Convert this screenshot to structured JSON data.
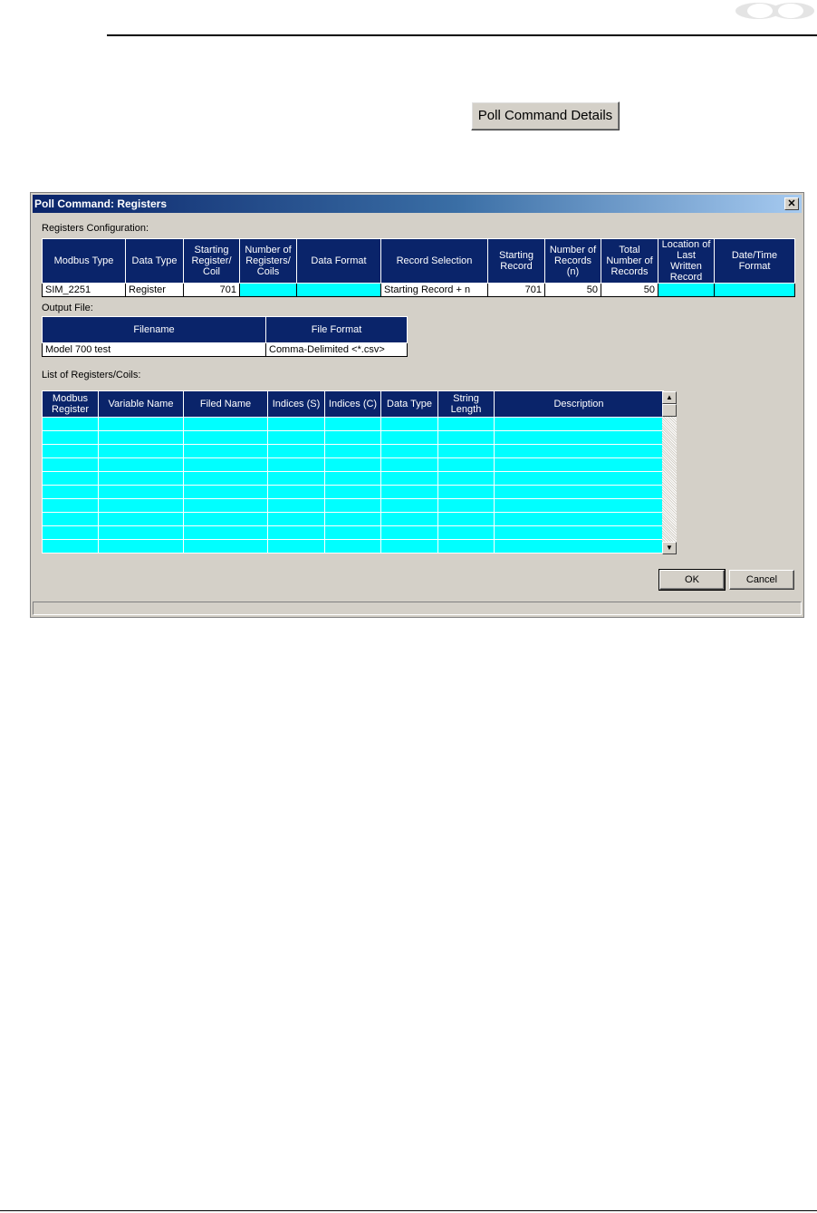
{
  "page": {
    "poll_button_label": "Poll Command Details"
  },
  "dialog": {
    "title": "Poll Command: Registers",
    "close_glyph": "✕",
    "registers_section_label": "Registers Configuration:",
    "registers_columns": [
      "Modbus Type",
      "Data Type",
      "Starting Register/ Coil",
      "Number of Registers/ Coils",
      "Data Format",
      "Record Selection",
      "Starting Record",
      "Number of Records (n)",
      "Total Number of Records",
      "Location of Last Written Record",
      "Date/Time Format"
    ],
    "registers_row": {
      "modbus_type": "SIM_2251",
      "data_type": "Register",
      "starting_register": "701",
      "number_of_registers": "",
      "data_format": "",
      "record_selection": "Starting Record + n",
      "starting_record": "701",
      "number_of_records": "50",
      "total_records": "50",
      "location_last_written": "",
      "datetime_format": ""
    },
    "output_section_label": "Output File:",
    "output_columns": [
      "Filename",
      "File Format"
    ],
    "output_row": {
      "filename": "Model 700 test",
      "file_format": "Comma-Delimited <*.csv>"
    },
    "list_section_label": "List of Registers/Coils:",
    "list_columns": [
      "Modbus Register",
      "Variable Name",
      "Filed Name",
      "Indices (S)",
      "Indices (C)",
      "Data Type",
      "String Length",
      "Description"
    ],
    "list_empty_rows": 10,
    "ok_label": "OK",
    "cancel_label": "Cancel"
  },
  "colors": {
    "header_bg": "#0a246a",
    "cell_highlight": "#00ffff",
    "dialog_bg": "#d4d0c8"
  },
  "icons": [
    "logo-mark-icon",
    "close-icon",
    "scroll-up-arrow-icon",
    "scroll-down-arrow-icon"
  ]
}
